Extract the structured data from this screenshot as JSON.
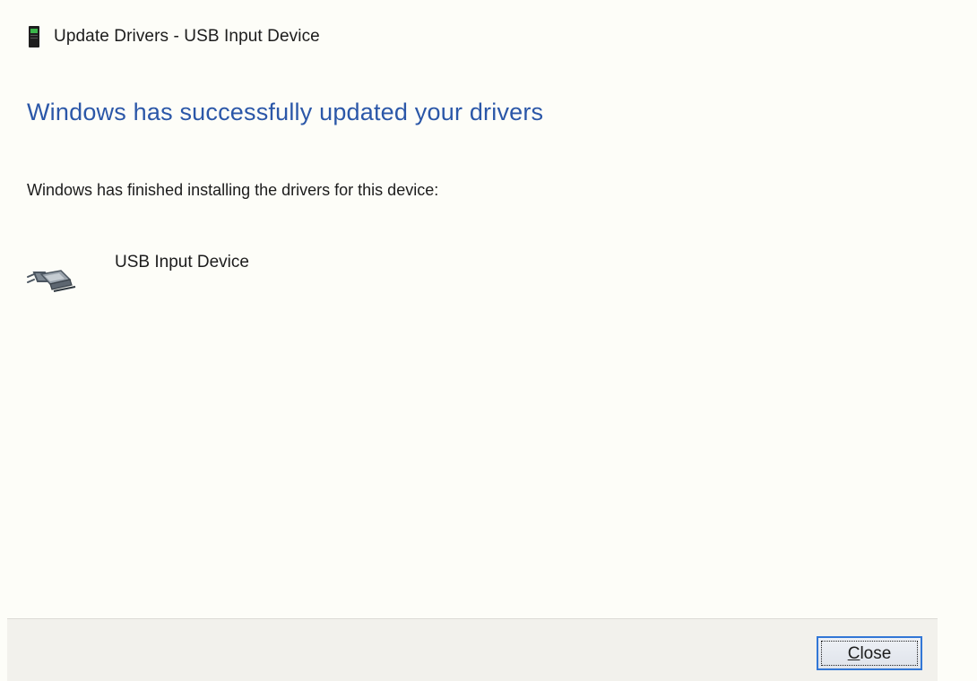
{
  "window": {
    "title": "Update Drivers - USB Input Device",
    "icon": "device-manager-icon"
  },
  "main": {
    "heading": "Windows has successfully updated your drivers",
    "message": "Windows has finished installing the drivers for this device:",
    "device": {
      "name": "USB Input Device",
      "icon": "usb-device-icon"
    }
  },
  "footer": {
    "close_mnemonic": "C",
    "close_rest": "lose"
  },
  "colors": {
    "heading": "#2b57a8",
    "background": "#fdfdf8",
    "footer": "#f2f1ec",
    "button_focus": "#3277d6"
  }
}
